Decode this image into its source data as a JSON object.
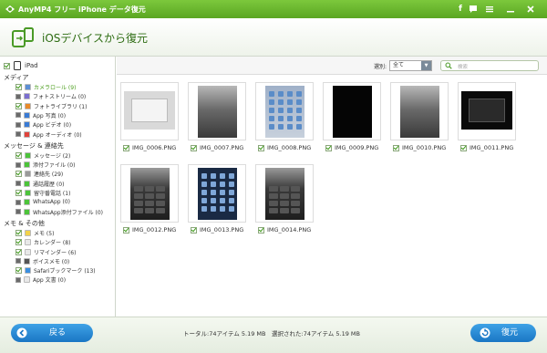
{
  "titlebar": {
    "title": "AnyMP4 フリー iPhone データ復元"
  },
  "header": {
    "title": "iOSデバイスから復元"
  },
  "sidebar": {
    "device": "iPad",
    "categories": [
      {
        "label": "メディア",
        "items": [
          {
            "label": "カメラロール (9)",
            "checked": true,
            "active": true,
            "icon_color": "#5b8fd4"
          },
          {
            "label": "フォトストリーム (0)",
            "checked": false,
            "icon_color": "#7b6fd0"
          },
          {
            "label": "フォトライブラリ (1)",
            "checked": true,
            "icon_color": "#e88a2a"
          },
          {
            "label": "App 写真 (0)",
            "checked": false,
            "icon_color": "#3a7bd5"
          },
          {
            "label": "App ビデオ (0)",
            "checked": false,
            "icon_color": "#3a7bd5"
          },
          {
            "label": "App オーディオ (0)",
            "checked": false,
            "icon_color": "#e0443c"
          }
        ]
      },
      {
        "label": "メッセージ & 連絡先",
        "items": [
          {
            "label": "メッセージ (2)",
            "checked": true,
            "icon_color": "#4cc43a"
          },
          {
            "label": "添付ファイル (0)",
            "checked": false,
            "icon_color": "#4cc43a"
          },
          {
            "label": "連絡先 (29)",
            "checked": true,
            "icon_color": "#9a9a9a"
          },
          {
            "label": "通話履歴 (0)",
            "checked": false,
            "icon_color": "#4cc43a"
          },
          {
            "label": "留守番電話 (1)",
            "checked": true,
            "icon_color": "#4cc43a"
          },
          {
            "label": "WhatsApp (0)",
            "checked": false,
            "icon_color": "#4cc43a"
          },
          {
            "label": "WhatsApp添付ファイル (0)",
            "checked": false,
            "icon_color": "#4cc43a"
          }
        ]
      },
      {
        "label": "メモ & その他",
        "items": [
          {
            "label": "メモ (5)",
            "checked": true,
            "icon_color": "#f2d24a"
          },
          {
            "label": "カレンダー (8)",
            "checked": true,
            "icon_color": "#e8e8e8"
          },
          {
            "label": "リマインダー (6)",
            "checked": true,
            "icon_color": "#e8e8e8"
          },
          {
            "label": "ボイスメモ (0)",
            "checked": false,
            "icon_color": "#555555"
          },
          {
            "label": "Safariブックマーク (13)",
            "checked": true,
            "icon_color": "#3a8fe0"
          },
          {
            "label": "App 文書 (0)",
            "checked": false,
            "icon_color": "#e8e8e8"
          }
        ]
      }
    ]
  },
  "toolbar": {
    "filter_label": "選別:",
    "filter_value": "全て",
    "search_placeholder": "検索"
  },
  "thumbnails": [
    {
      "name": "IMG_0006.PNG",
      "kind": "landscape-screen"
    },
    {
      "name": "IMG_0007.PNG",
      "kind": "gray-screen"
    },
    {
      "name": "IMG_0008.PNG",
      "kind": "home-screen"
    },
    {
      "name": "IMG_0009.PNG",
      "kind": "black-screen"
    },
    {
      "name": "IMG_0010.PNG",
      "kind": "gray-screen"
    },
    {
      "name": "IMG_0011.PNG",
      "kind": "dark-landscape"
    },
    {
      "name": "IMG_0012.PNG",
      "kind": "keypad-screen"
    },
    {
      "name": "IMG_0013.PNG",
      "kind": "grid-screen"
    },
    {
      "name": "IMG_0014.PNG",
      "kind": "keypad-screen"
    }
  ],
  "footer": {
    "back_label": "戻る",
    "total": "トータル:74アイテム 5.19 MB",
    "selected": "選択された:74アイテム 5.19 MB",
    "recover_label": "復元"
  },
  "colors": {
    "brand_green": "#5aa622",
    "button_blue": "#1976c4"
  }
}
